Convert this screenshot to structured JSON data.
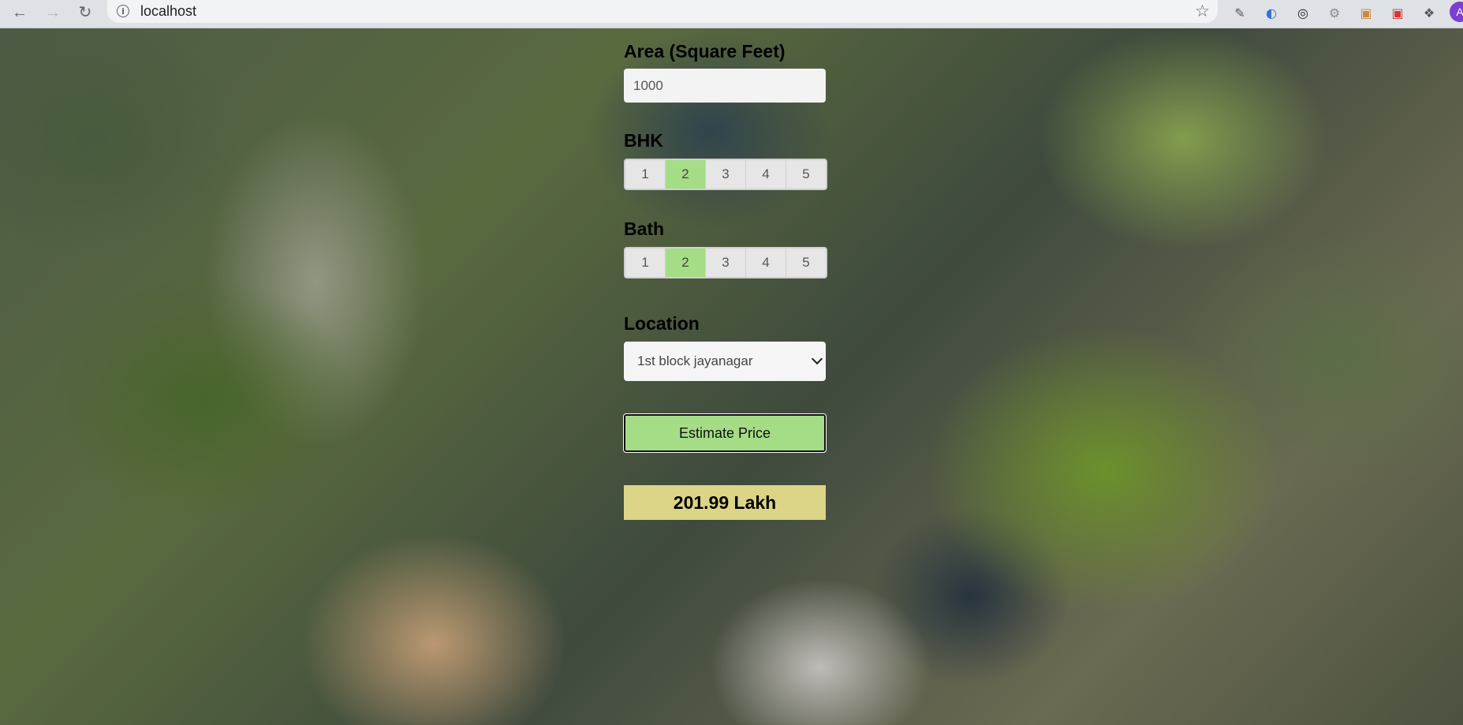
{
  "browser": {
    "url": "localhost",
    "avatar_initial": "A"
  },
  "form": {
    "area": {
      "label": "Area (Square Feet)",
      "value": "1000"
    },
    "bhk": {
      "label": "BHK",
      "options": [
        "1",
        "2",
        "3",
        "4",
        "5"
      ],
      "selected": "2"
    },
    "bath": {
      "label": "Bath",
      "options": [
        "1",
        "2",
        "3",
        "4",
        "5"
      ],
      "selected": "2"
    },
    "location": {
      "label": "Location",
      "value": "1st block jayanagar"
    },
    "estimate_button": "Estimate Price",
    "result": "201.99 Lakh"
  },
  "colors": {
    "selected_option": "#a5dc86",
    "estimate_button": "#a5dc86",
    "result_background": "#dcd486"
  },
  "icons": [
    "back-icon",
    "forward-icon",
    "reload-icon",
    "info-icon",
    "star-icon",
    "eyedropper-icon",
    "extension-icon",
    "puzzle-icon",
    "chevron-down-icon"
  ]
}
